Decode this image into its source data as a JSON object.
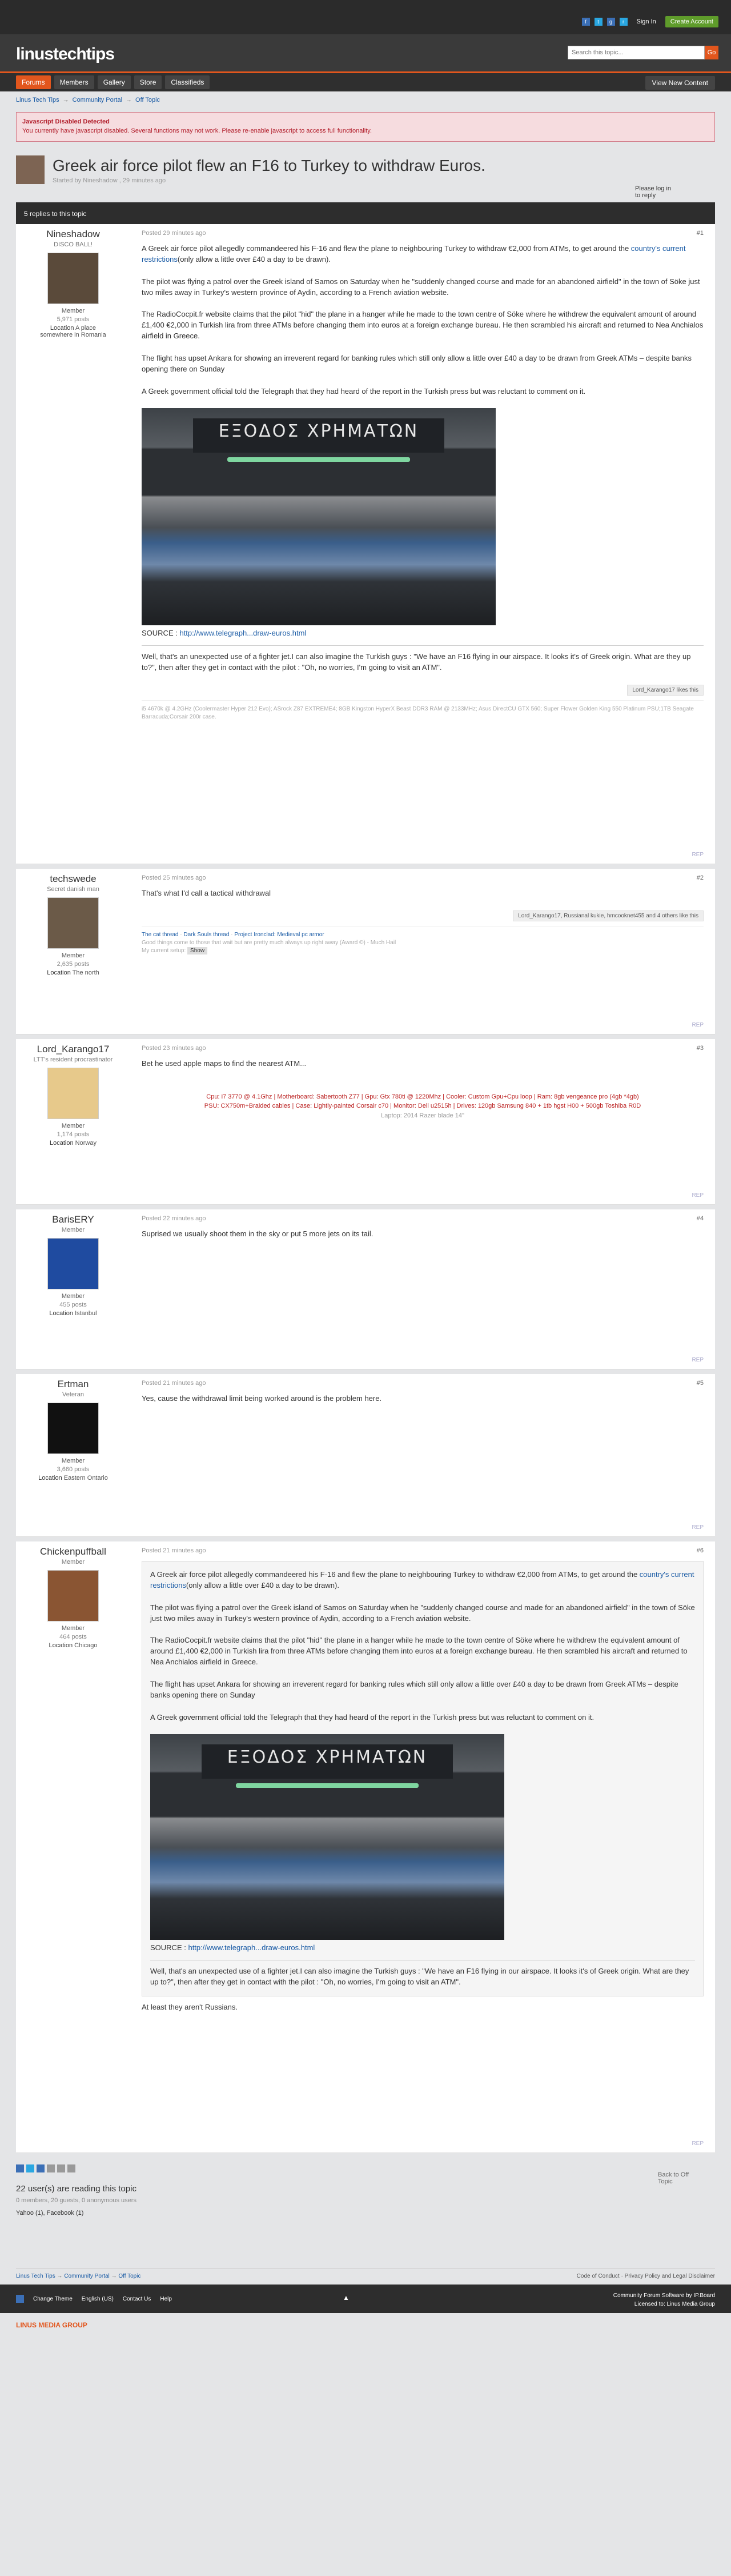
{
  "topbar": {
    "sign_in": "Sign In",
    "create_account": "Create Account",
    "fb": "f",
    "tw": "t",
    "gp": "g",
    "rss": "r"
  },
  "header": {
    "logo": "linustechtips",
    "search_placeholder": "Search this topic...",
    "search_btn": "Go"
  },
  "nav": {
    "tabs": [
      "Forums",
      "Members",
      "Gallery",
      "Store",
      "Classifieds"
    ],
    "view_new": "View New Content"
  },
  "breadcrumbs": [
    "Linus Tech Tips",
    "Community Portal",
    "Off Topic"
  ],
  "alert": {
    "title": "Javascript Disabled Detected",
    "text": "You currently have javascript disabled. Several functions may not work. Please re-enable javascript to access full functionality."
  },
  "topic": {
    "title": "Greek air force pilot flew an F16 to Turkey to withdraw Euros.",
    "started": "Started by Nineshadow , 29 minutes ago",
    "reply": "Please log in to reply"
  },
  "replies_bar": "5 replies to this topic",
  "article": {
    "p1a": "A Greek air force pilot allegedly commandeered his F-16 and flew the plane to neighbouring Turkey to withdraw €2,000 from ATMs, to get around the ",
    "p1link": "country's current restrictions",
    "p1b": "(only allow a little over £40 a day to be drawn).",
    "p2": "The pilot was flying a patrol over the Greek island of Samos on Saturday when he \"suddenly changed course and made for an abandoned airfield\" in the town of Söke just two miles away in Turkey's western province of Aydin, according to a French aviation website.",
    "p3": "The RadioCocpit.fr website claims that the pilot \"hid\" the plane in a hanger while he made to the town centre of Söke where he withdrew the equivalent amount of around £1,400 €2,000 in Turkish lira from three ATMs before changing them into euros at a foreign exchange bureau. He then scrambled his aircraft and returned to Nea Anchialos airfield in Greece.",
    "p4": "The flight has upset Ankara for showing an irreverent regard for banking rules which still only allow a little over £40 a day to be drawn from Greek ATMs – despite banks opening there on Sunday",
    "p5": "A Greek government official told the Telegraph that they had heard of the report in the Turkish press but was reluctant to comment on it.",
    "sign": "ΕΞΟΔΟΣ ΧΡΗΜΑΤΩΝ",
    "source_label": "SOURCE : ",
    "source_link": "http://www.telegraph...draw-euros.html",
    "comment": "Well, that's an unexpected use of a fighter jet.I can also imagine the Turkish guys : \"We have an F16 flying in our airspace. It looks it's of Greek origin. What are they up to?\", then after they get in contact with the pilot : \"Oh, no worries, I'm going to visit an ATM\"."
  },
  "posts": [
    {
      "name": "Nineshadow",
      "title": "DISCO BALL!",
      "group": "Member",
      "count": "5,971 posts",
      "loc_label": "Location",
      "loc": "A place somewhere in Romania",
      "time": "Posted 29 minutes ago",
      "num": "#1",
      "likes": "Lord_Karango17 likes this",
      "sig": "i5 4670k @ 4.2GHz (Coolermaster Hyper 212 Evo); ASrock Z87 EXTREME4; 8GB Kingston HyperX Beast DDR3 RAM @ 2133MHz; Asus DirectCU GTX 560; Super Flower Golden King 550 Platinum PSU;1TB Seagate Barracuda;Corsair 200r case.",
      "rep": "REP"
    },
    {
      "name": "techswede",
      "title": "Secret danish man",
      "group": "Member",
      "count": "2,635 posts",
      "loc_label": "Location",
      "loc": "The north",
      "time": "Posted 25 minutes ago",
      "num": "#2",
      "text": "That's what I'd call a tactical withdrawal",
      "likes": "Lord_Karango17, Russianal kukie, hmcooknet455 and 4 others like this",
      "sig1": "The cat thread",
      "sig2": "Dark Souls thread",
      "sig3": "Project Ironclad: Medieval pc armor",
      "sig4": "Good things come to those that wait but are pretty much always up right away (Award ©) - Much Hail",
      "sig5": "My current setup:",
      "show": "Show",
      "rep": "REP"
    },
    {
      "name": "Lord_Karango17",
      "title": "LTT's resident procrastinator",
      "group": "Member",
      "count": "1,174 posts",
      "loc_label": "Location",
      "loc": "Norway",
      "time": "Posted 23 minutes ago",
      "num": "#3",
      "text": "Bet he used apple maps to find the nearest ATM...",
      "sig_a": "Cpu: i7 3770 @ 4.1Ghz | Motherboard: Sabertooth Z77 | Gpu: Gtx 780ti @ 1220Mhz | Cooler: Custom Gpu+Cpu loop | Ram: 8gb vengeance pro (4gb *4gb)",
      "sig_b": "PSU: CX750m+Braided cables | Case: Lightly-painted Corsair c70 | Monitor: Dell u2515h | Drives: 120gb Samsung 840 + 1tb hgst H00 + 500gb Toshiba R0D",
      "sig_c": "Laptop: 2014 Razer blade 14\"",
      "rep": "REP"
    },
    {
      "name": "BarisERY",
      "title": "Member",
      "group": "Member",
      "count": "455 posts",
      "loc_label": "Location",
      "loc": "Istanbul",
      "time": "Posted 22 minutes ago",
      "num": "#4",
      "text": "Suprised we usually shoot them in the sky or put 5 more jets on its tail.",
      "rep": "REP"
    },
    {
      "name": "Ertman",
      "title": "Veteran",
      "group": "Member",
      "count": "3,660 posts",
      "loc_label": "Location",
      "loc": "Eastern Ontario",
      "time": "Posted 21 minutes ago",
      "num": "#5",
      "text": "Yes, cause the withdrawal limit being worked around is the problem here.",
      "rep": "REP"
    },
    {
      "name": "Chickenpuffball",
      "title": "Member",
      "group": "Member",
      "count": "464 posts",
      "loc_label": "Location",
      "loc": "Chicago",
      "time": "Posted 21 minutes ago",
      "num": "#6",
      "text": "At least they aren't Russians.",
      "rep": "REP"
    }
  ],
  "footer": {
    "back": "Back to Off Topic",
    "reading": "22 user(s) are reading this topic",
    "reading_sub": "0 members, 20 guests, 0 anonymous users",
    "users": "Yahoo (1), Facebook (1)",
    "crumbs": [
      "Linus Tech Tips",
      "Community Portal",
      "Off Topic"
    ],
    "right": "Code of Conduct · Privacy Policy and Legal Disclaimer"
  },
  "bottom": {
    "change_theme": "Change Theme",
    "lang": "English (US)",
    "contact": "Contact Us",
    "help": "Help",
    "right1": "Community Forum Software by IP.Board",
    "right2": "Licensed to: Linus Media Group",
    "up": "▲"
  },
  "lmg": "LINUS MEDIA GROUP"
}
